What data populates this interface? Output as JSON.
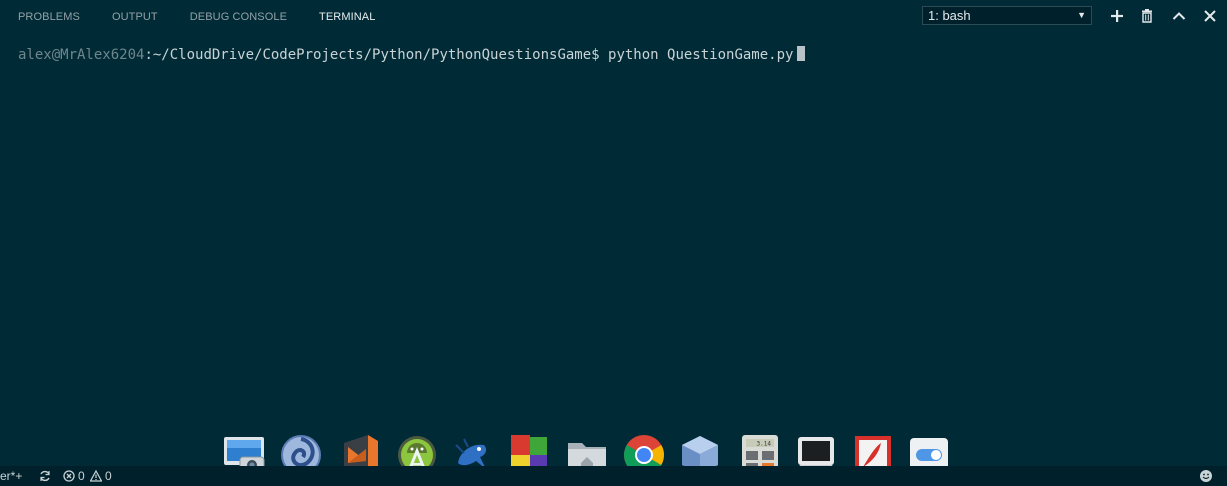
{
  "panel": {
    "tabs": [
      {
        "label": "PROBLEMS",
        "active": false
      },
      {
        "label": "OUTPUT",
        "active": false
      },
      {
        "label": "DEBUG CONSOLE",
        "active": false
      },
      {
        "label": "TERMINAL",
        "active": true
      }
    ],
    "terminal_select": {
      "value": "1: bash",
      "arrow": "▼"
    },
    "actions": [
      "plus-icon",
      "trash-icon",
      "chevron-up-icon"
    ]
  },
  "terminal": {
    "user_host": "alex@MrAlex6204",
    "path": ":~/CloudDrive/CodeProjects/Python/PythonQuestionsGame$",
    "command": " python QuestionGame.py"
  },
  "statusbar": {
    "branch_fragment": "er*+",
    "errors": "0",
    "warnings": "0"
  },
  "dock": {
    "items": [
      {
        "icon": "screenshot-app-icon",
        "running": true
      },
      {
        "icon": "eclipse-like-swirl-icon",
        "running": false
      },
      {
        "icon": "visual-studio-code-icon",
        "running": true
      },
      {
        "icon": "android-studio-icon",
        "running": true
      },
      {
        "icon": "bluefish-editor-icon",
        "running": false
      },
      {
        "icon": "colorful-cube-app-icon",
        "running": true
      },
      {
        "icon": "home-folder-icon",
        "running": true
      },
      {
        "icon": "chrome-icon",
        "running": true
      },
      {
        "icon": "virtualbox-cube-icon",
        "running": false
      },
      {
        "icon": "calculator-icon",
        "running": false
      },
      {
        "icon": "terminal-monitor-icon",
        "running": true
      },
      {
        "icon": "pdf-reader-icon",
        "running": false
      },
      {
        "icon": "toggle-settings-icon",
        "running": false
      }
    ],
    "calculator_display": "3.14"
  },
  "colors": {
    "background": "#002b36",
    "statusbar": "#00212b",
    "running_dot": "#2a8fd5"
  }
}
